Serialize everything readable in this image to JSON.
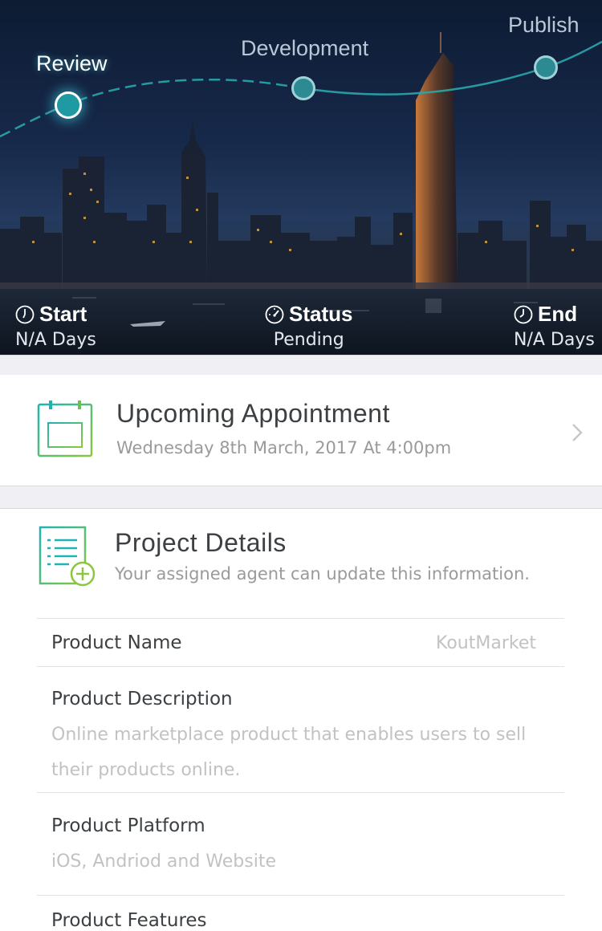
{
  "stages": [
    {
      "label": "Review",
      "state": "active"
    },
    {
      "label": "Development",
      "state": "upcoming"
    },
    {
      "label": "Publish",
      "state": "upcoming"
    }
  ],
  "stats": {
    "start": {
      "label": "Start",
      "value": "N/A Days"
    },
    "status": {
      "label": "Status",
      "value": "Pending"
    },
    "end": {
      "label": "End",
      "value": "N/A Days"
    }
  },
  "appointment": {
    "title": "Upcoming Appointment",
    "datetime": "Wednesday 8th March, 2017 At 4:00pm"
  },
  "project_details": {
    "title": "Project Details",
    "subtitle": "Your assigned agent can update this information.",
    "fields": [
      {
        "label": "Product Name",
        "value": "KoutMarket"
      },
      {
        "label": "Product Description",
        "value": "Online marketplace product that enables users to sell their products online."
      },
      {
        "label": "Product Platform",
        "value": "iOS, Andriod and Website"
      },
      {
        "label": "Product Features",
        "value": ""
      }
    ]
  },
  "colors": {
    "accent": "#1f9aa2",
    "icon_gradient_start": "#1fb3b3",
    "icon_gradient_end": "#8cc63f"
  }
}
